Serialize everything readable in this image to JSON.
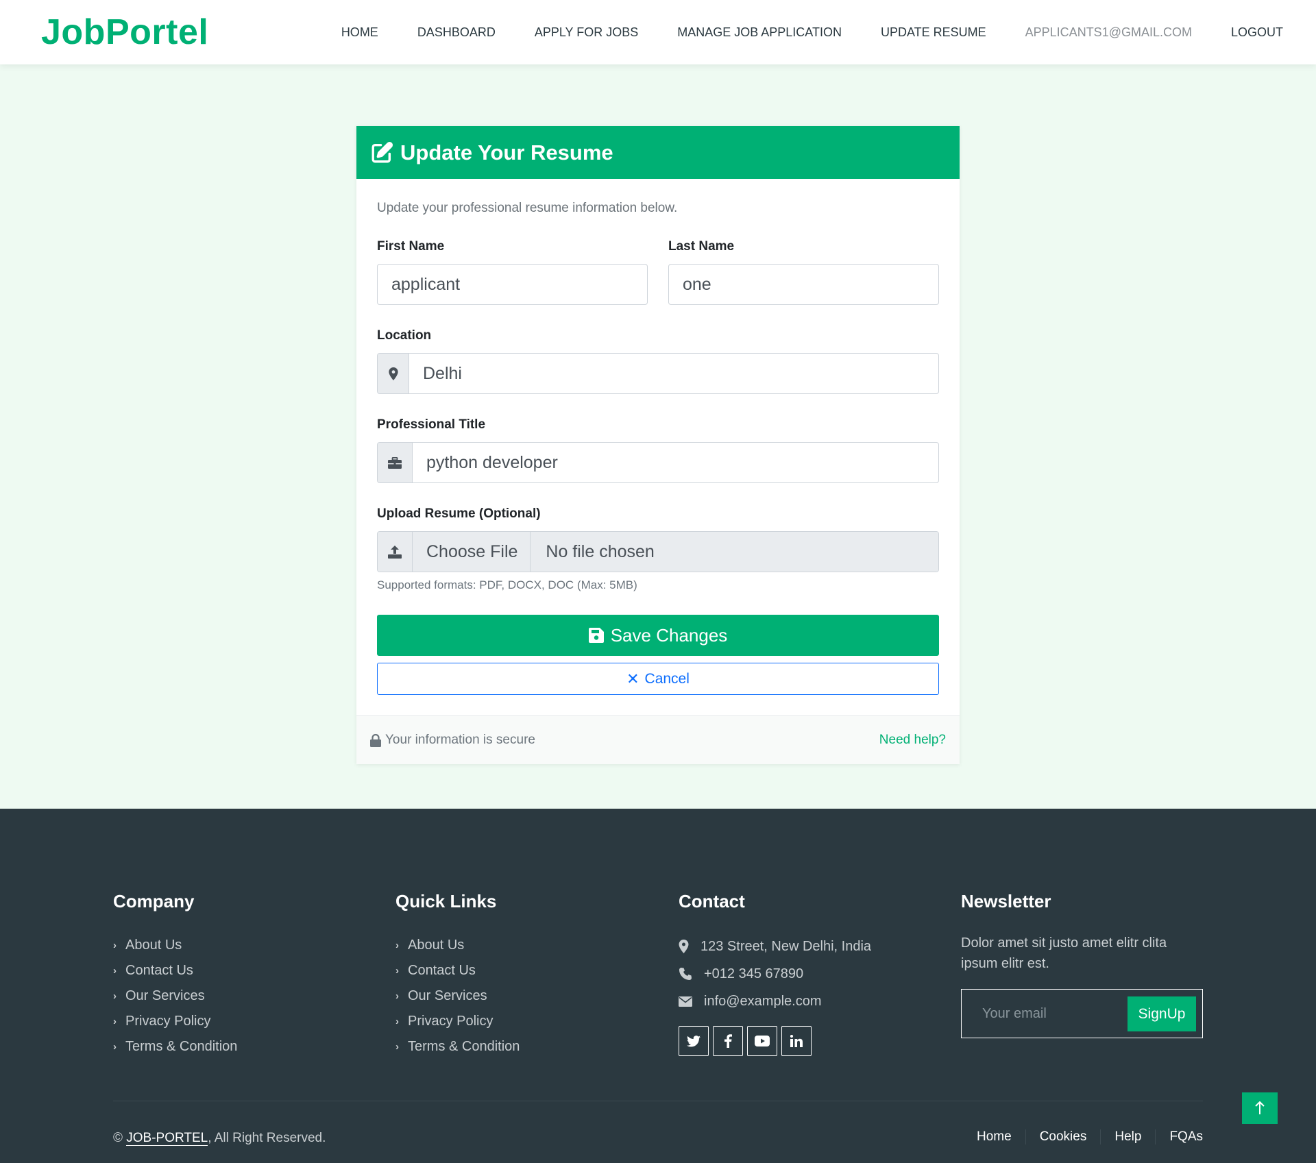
{
  "brand": "JobPortel",
  "nav": {
    "home": "HOME",
    "dashboard": "DASHBOARD",
    "apply": "APPLY FOR JOBS",
    "manage": "MANAGE JOB APPLICATION",
    "update": "UPDATE RESUME",
    "email": "APPLICANTS1@GMAIL.COM",
    "logout": "LOGOUT"
  },
  "form": {
    "title": "Update Your Resume",
    "subtitle": "Update your professional resume information below.",
    "first_name_label": "First Name",
    "first_name_value": "applicant",
    "last_name_label": "Last Name",
    "last_name_value": "one",
    "location_label": "Location",
    "location_value": "Delhi",
    "title_label": "Professional Title",
    "title_value": "python developer",
    "upload_label": "Upload Resume (Optional)",
    "choose_file": "Choose File",
    "no_file": "No file chosen",
    "formats_hint": "Supported formats: PDF, DOCX, DOC (Max: 5MB)",
    "save_label": "Save Changes",
    "cancel_label": "Cancel",
    "secure_text": "Your information is secure",
    "help_link": "Need help?"
  },
  "footer": {
    "company": {
      "heading": "Company",
      "links": [
        "About Us",
        "Contact Us",
        "Our Services",
        "Privacy Policy",
        "Terms & Condition"
      ]
    },
    "quick": {
      "heading": "Quick Links",
      "links": [
        "About Us",
        "Contact Us",
        "Our Services",
        "Privacy Policy",
        "Terms & Condition"
      ]
    },
    "contact": {
      "heading": "Contact",
      "address": "123 Street, New Delhi, India",
      "phone": "+012 345 67890",
      "email": "info@example.com"
    },
    "newsletter": {
      "heading": "Newsletter",
      "text": "Dolor amet sit justo amet elitr clita ipsum elitr est.",
      "placeholder": "Your email",
      "button": "SignUp"
    },
    "copyright_symbol": "©",
    "copyright_brand": "JOB-PORTEL",
    "copyright_rest": ", All Right Reserved.",
    "menu": [
      "Home",
      "Cookies",
      "Help",
      "FQAs"
    ]
  },
  "colors": {
    "accent": "#00b074",
    "footer_bg": "#2b3940",
    "page_bg": "#eefaf2",
    "cancel_blue": "#0d6efd"
  },
  "icons": [
    "edit-icon",
    "map-marker-icon",
    "briefcase-icon",
    "upload-icon",
    "save-icon",
    "close-icon",
    "lock-icon",
    "chevron-right-icon",
    "phone-icon",
    "envelope-icon",
    "twitter-icon",
    "facebook-icon",
    "youtube-icon",
    "linkedin-icon",
    "arrow-up-icon"
  ]
}
